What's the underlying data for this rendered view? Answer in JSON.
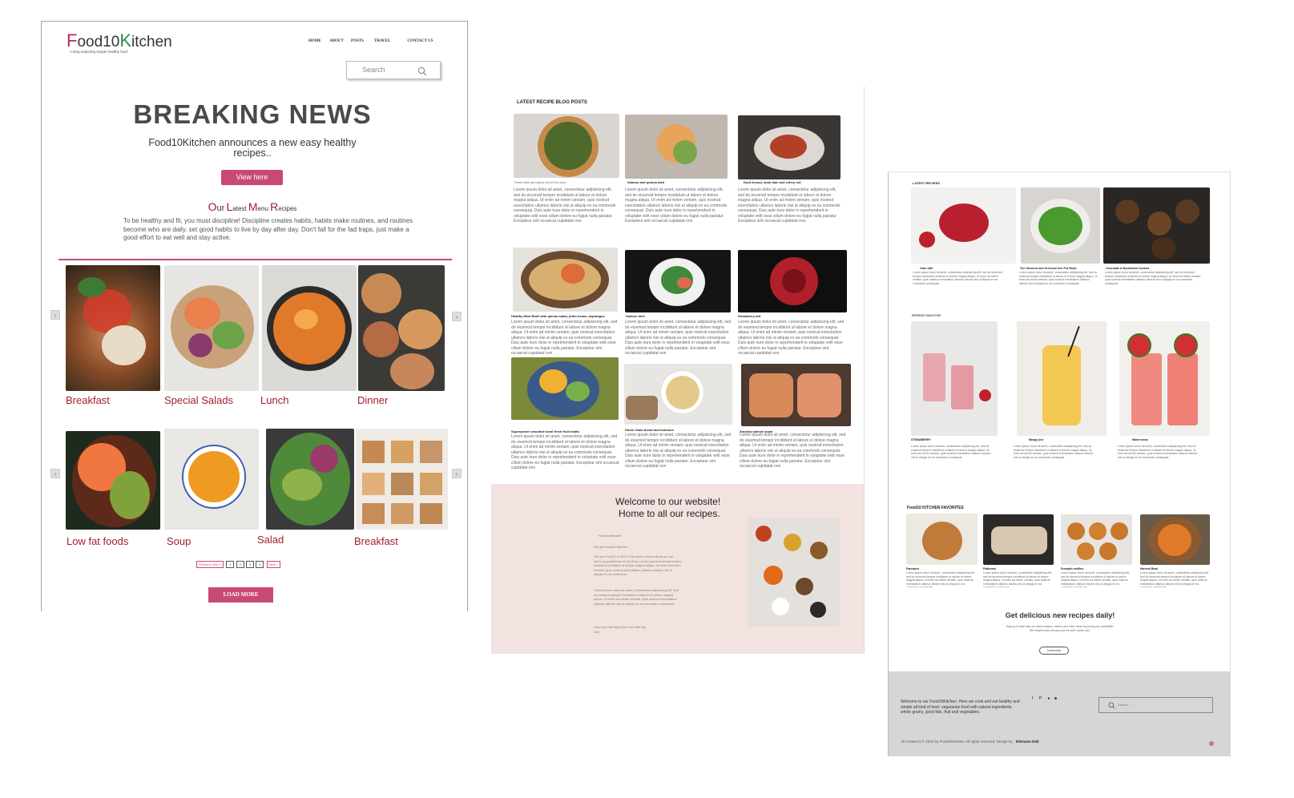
{
  "panel1": {
    "logo_full": "Food10Kitchen",
    "tagline": "A blog exploring simple healthy food",
    "nav": [
      "HOME",
      "ABOUT",
      "POSTS",
      "TRAVEL",
      "CONTACT US"
    ],
    "search_placeholder": "Search",
    "hero_title": "BREAKING NEWS",
    "hero_sub1": "Food10Kitchen announces a new easy healthy",
    "hero_sub2": "recipes..",
    "view_label": "View here",
    "menu_heading": "Our Latest Menu Recipes",
    "intro": "To be healthy and fit, you must discipline! Discipline creates habits, habits make routines, and routines become who are  daily. set good habits to live by day after day. Don't fall for the fad traps, just make a good effort to eat well and stay active.",
    "row1": [
      "Breakfast",
      "Special Salads",
      "Lunch",
      "Dinner"
    ],
    "row2": [
      "Low fat foods",
      "Soup",
      "Salad",
      "Breakfast"
    ],
    "pagination": [
      "Previous view «",
      "1",
      "2",
      "3",
      "4",
      "Next »"
    ],
    "load_more": "LOAD MORE"
  },
  "panel2": {
    "heading": "LATEST RECIPE BLOG POSTS",
    "captions": [
      "Fresh kale and pizza red of the oven",
      "Salmon and quinoa dish",
      "Duck breast, lamb kale and celery red",
      "Healthy Meal Bowl with quinoa salad, pinto beans, asparagus",
      "Salmon dish",
      "Strawberry tart",
      "Superpower smoothie bowl fresh fruit health",
      "Home made bread and hummus",
      "Smoked salmon toast"
    ],
    "lorem": "Lorem ipsum dolor sit amet, consectetur adipisicing elit, sed do eiusmod tempor incididunt ut labore et dolore magna aliqua. Ut enim ad minim veniam, quis nostrud exercitation ullamco laboris nisi ut aliquip ex ea commodo consequat. Duis aute irure dolor in reprehenderit in voluptate velit esse cillum dolore eu fugiat nulla pariatur. Excepteur sint occaecat cupidatat non",
    "welcome1": "Welcome to our website!",
    "welcome2": "Home to all our recipes.",
    "small1": "Hi and welcome",
    "small2": "We are Food10 Kitchen",
    "para1": "We are Food10 in 2022! This text is where about you as other, acquaintance of the blog. Lorem ipsum eiusmod tempor incididunt ut labore et dolore magna aliqua. Ut enim ad minim veniam, quis nostrud exercitation ullamco laboris nisi ut aliquip ex ea commodo.",
    "para2": "Lorem ipsum dolor sit amet, consectetur adipisicing elit, sed do eiusmod tempor incididunt ut labore et dolore magna aliqua. Ut enim ad minim veniam, quis nostrud exercitation ullamco laboris nisi ut aliquip ex ea commodo consequat.",
    "sign": "Hope you will enjoy the new site! Big love"
  },
  "panel3": {
    "latest_heading": "LATEST RECIPES",
    "latest_caps": [
      "Cake with",
      "The Greenest and Greenest One Pot Pasta",
      "Chocolate & Buckwheat Cookies"
    ],
    "smoothie_heading": "REFRESH SMOOTHIE",
    "smoothie_caps": [
      "STRAWBERRY",
      "Mango jinx",
      "Watermelon"
    ],
    "fav_heading": "Food10 KITCHEN FAVORITES",
    "fav_caps": [
      "Pancakes",
      "Flatbread",
      "Pumpkin muffins",
      "Harvest Bowl"
    ],
    "lorem": "Lorem ipsum dolor sit amet, consectetur adipisicing elit, sed do eiusmod tempor incididunt ut labore et dolore magna aliqua. Ut enim ad minim veniam, quis nostrud exercitation ullamco laboris nisi ut aliquip ex ea commodo consequat.",
    "newsletter_title": "Get delicious new recipes daily!",
    "newsletter_text": "Stay up to date with our latest recipes, videos and other news by joining our newsletter. We respect your privacy and we won't spam you.",
    "subscribe": "SUBSCRIBE",
    "footer_about": "Welcome to our Food10Kitchen. Here we cook and eat healthy and simple all kind of food- vegetarian food with natural ingredients, whole grains, good fats, fruit and vegetables.",
    "footer_search": "Search",
    "copyright": "All content is © 2022 by Food10Kitchen. All rights reserved. Design by",
    "designer": "Ethmane Didi"
  }
}
